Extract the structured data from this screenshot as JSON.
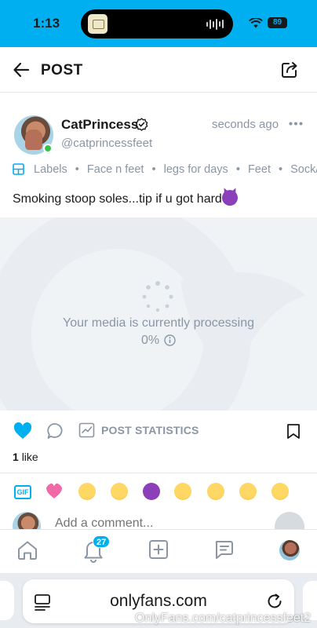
{
  "status_bar": {
    "time": "1:13",
    "battery": "89"
  },
  "header": {
    "title": "POST"
  },
  "post": {
    "author_name": "CatPrincess",
    "author_handle": "@catprincessfeet",
    "time": "seconds ago",
    "labels_title": "Labels",
    "labels": [
      "Face n feet",
      "legs for days",
      "Feet",
      "Sock/sho"
    ],
    "text": "Smoking stoop soles...tip if u got hard",
    "media": {
      "processing_text": "Your media is currently processing",
      "progress_percent": "0%"
    },
    "stats_label": "POST STATISTICS",
    "likes": {
      "count": "1",
      "label": "like"
    }
  },
  "comment": {
    "placeholder": "Add a comment..."
  },
  "nav": {
    "notifications_badge": "27"
  },
  "browser": {
    "url": "onlyfans.com"
  },
  "watermark": "OnlyFans.com/catprincessfeet2",
  "colors": {
    "accent": "#00aff0",
    "muted": "#8a96a3",
    "online": "#36c24a"
  },
  "icons": {
    "emoji_bar": [
      "gif-icon",
      "pink-heart-emoji",
      "smiling-hearts-emoji",
      "eye-roll-emoji",
      "devil-emoji",
      "kiss-emoji",
      "grin-emoji",
      "beaming-emoji",
      "tears-of-joy-emoji"
    ]
  }
}
